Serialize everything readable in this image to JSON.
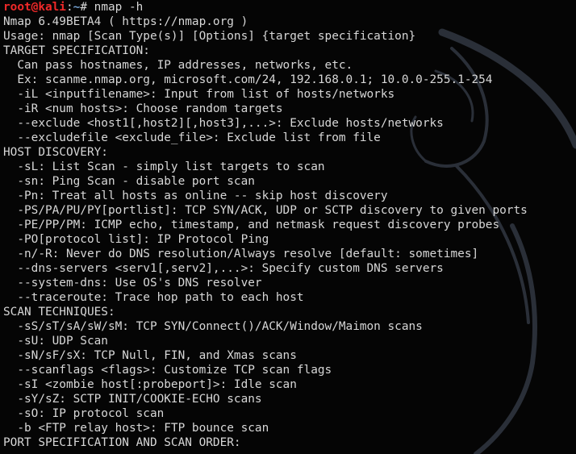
{
  "prompt": {
    "user_host": "root@kali",
    "separator": ":",
    "path": "~",
    "symbol": "# ",
    "command": "nmap -h"
  },
  "output_lines": [
    "Nmap 6.49BETA4 ( https://nmap.org )",
    "Usage: nmap [Scan Type(s)] [Options] {target specification}",
    "TARGET SPECIFICATION:",
    "  Can pass hostnames, IP addresses, networks, etc.",
    "  Ex: scanme.nmap.org, microsoft.com/24, 192.168.0.1; 10.0.0-255.1-254",
    "  -iL <inputfilename>: Input from list of hosts/networks",
    "  -iR <num hosts>: Choose random targets",
    "  --exclude <host1[,host2][,host3],...>: Exclude hosts/networks",
    "  --excludefile <exclude_file>: Exclude list from file",
    "HOST DISCOVERY:",
    "  -sL: List Scan - simply list targets to scan",
    "  -sn: Ping Scan - disable port scan",
    "  -Pn: Treat all hosts as online -- skip host discovery",
    "  -PS/PA/PU/PY[portlist]: TCP SYN/ACK, UDP or SCTP discovery to given ports",
    "  -PE/PP/PM: ICMP echo, timestamp, and netmask request discovery probes",
    "  -PO[protocol list]: IP Protocol Ping",
    "  -n/-R: Never do DNS resolution/Always resolve [default: sometimes]",
    "  --dns-servers <serv1[,serv2],...>: Specify custom DNS servers",
    "  --system-dns: Use OS's DNS resolver",
    "  --traceroute: Trace hop path to each host",
    "SCAN TECHNIQUES:",
    "  -sS/sT/sA/sW/sM: TCP SYN/Connect()/ACK/Window/Maimon scans",
    "  -sU: UDP Scan",
    "  -sN/sF/sX: TCP Null, FIN, and Xmas scans",
    "  --scanflags <flags>: Customize TCP scan flags",
    "  -sI <zombie host[:probeport]>: Idle scan",
    "  -sY/sZ: SCTP INIT/COOKIE-ECHO scans",
    "  -sO: IP protocol scan",
    "  -b <FTP relay host>: FTP bounce scan",
    "PORT SPECIFICATION AND SCAN ORDER:"
  ],
  "colors": {
    "background": "#050505",
    "text": "#d7d7d7",
    "prompt_user": "#ef2929",
    "prompt_path": "#729fcf",
    "watermark": "#2a2f38"
  },
  "background_art": "kali-dragon-watermark"
}
